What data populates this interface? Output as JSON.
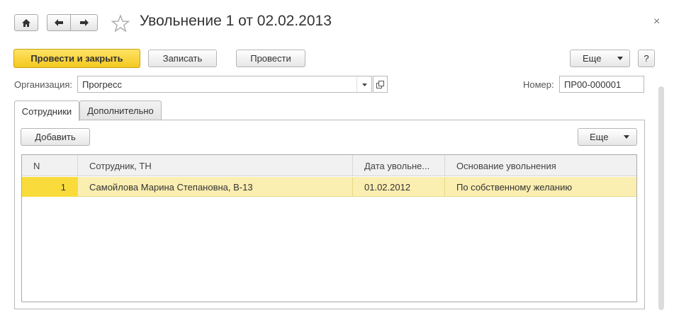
{
  "window": {
    "title": "Увольнение 1 от 02.02.2013",
    "close_glyph": "×"
  },
  "toolbar": {
    "post_close_label": "Провести и закрыть",
    "save_label": "Записать",
    "post_label": "Провести",
    "more_label": "Еще",
    "help_label": "?"
  },
  "fields": {
    "organization_label": "Организация:",
    "organization_value": "Прогресс",
    "number_label": "Номер:",
    "number_value": "ПР00-000001"
  },
  "tabs": [
    {
      "label": "Сотрудники",
      "active": true
    },
    {
      "label": "Дополнительно",
      "active": false
    }
  ],
  "table_toolbar": {
    "add_label": "Добавить",
    "more_label": "Еще"
  },
  "table": {
    "columns": [
      "N",
      "Сотрудник, ТН",
      "Дата увольне...",
      "Основание увольнения"
    ],
    "rows": [
      {
        "n": "1",
        "employee": "Самойлова Марина Степановна, В-13",
        "date": "01.02.2012",
        "reason": "По собственному желанию"
      }
    ]
  },
  "colors": {
    "primary_button": "#f4c81f",
    "selected_row": "#fbeeb1",
    "selected_cell": "#f9dc3c"
  },
  "icons": [
    "home-icon",
    "back-arrow-icon",
    "forward-arrow-icon",
    "star-icon",
    "close-icon",
    "dropdown-arrow-icon",
    "open-icon"
  ]
}
